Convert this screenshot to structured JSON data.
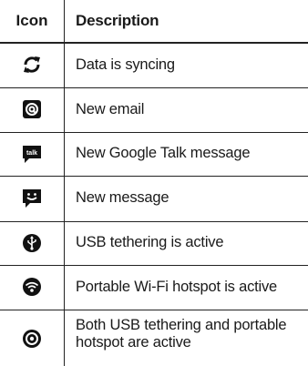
{
  "table": {
    "header": {
      "icon": "Icon",
      "description": "Description"
    },
    "rows": [
      {
        "icon": "sync-icon",
        "description": "Data is syncing"
      },
      {
        "icon": "email-icon",
        "description": "New email"
      },
      {
        "icon": "google-talk-icon",
        "description": "New Google Talk message"
      },
      {
        "icon": "message-icon",
        "description": "New message"
      },
      {
        "icon": "usb-tethering-icon",
        "description": "USB tethering is active"
      },
      {
        "icon": "wifi-hotspot-icon",
        "description": "Portable Wi-Fi hotspot is active"
      },
      {
        "icon": "usb-and-hotspot-icon",
        "description": "Both USB tethering and portable hotspot are active"
      }
    ]
  }
}
